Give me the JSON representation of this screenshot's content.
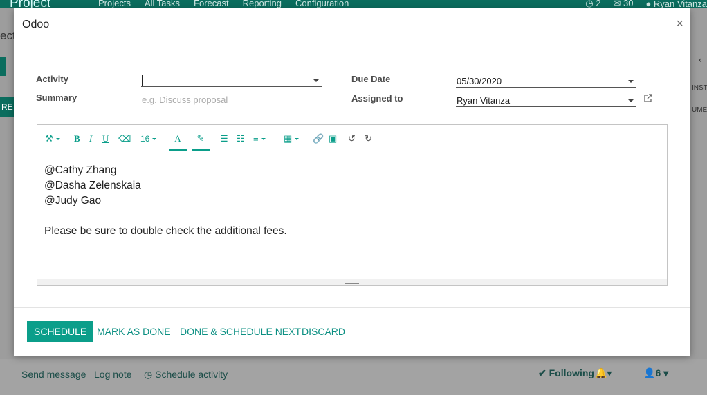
{
  "topbar": {
    "brand": "Project",
    "nav": [
      "Projects",
      "All Tasks",
      "Forecast",
      "Reporting",
      "Configuration"
    ],
    "activity_count": "2",
    "message_count": "30",
    "user_name": "Ryan Vitanza"
  },
  "background": {
    "title_fragment": "ect",
    "button_fragment": "RE",
    "right_fragment1": "INST",
    "right_fragment2": "UMEN",
    "chatter": {
      "send_message": "Send message",
      "log_note": "Log note",
      "schedule_activity": "Schedule activity",
      "following": "Following",
      "followers_count": "6"
    }
  },
  "dialog": {
    "title": "Odoo",
    "close": "×",
    "labels": {
      "activity": "Activity",
      "summary": "Summary",
      "due_date": "Due Date",
      "assigned_to": "Assigned to"
    },
    "fields": {
      "activity_value": "",
      "summary_placeholder": "e.g. Discuss proposal",
      "due_date_value": "05/30/2020",
      "assigned_value": "Ryan Vitanza"
    },
    "toolbar": {
      "font_size": "16"
    },
    "body_lines": [
      "@Cathy Zhang",
      "@Dasha Zelenskaia",
      "@Judy Gao",
      "",
      "Please be sure to double check the additional fees."
    ],
    "buttons": {
      "schedule": "SCHEDULE",
      "mark_done": "MARK AS DONE",
      "done_next": "DONE & SCHEDULE NEXT",
      "discard": "DISCARD"
    }
  },
  "colors": {
    "brand": "#0b6d5e",
    "accent": "#0b9e8a"
  }
}
